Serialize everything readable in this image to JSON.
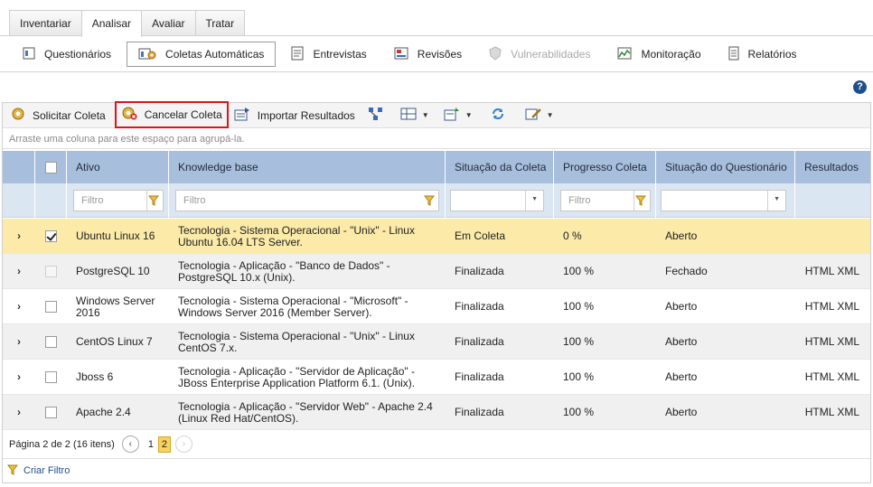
{
  "top_tabs": [
    "Inventariar",
    "Analisar",
    "Avaliar",
    "Tratar"
  ],
  "active_tab": "Analisar",
  "subnav": [
    {
      "label": "Questionários",
      "icon": "questionnaire-icon",
      "state": "normal"
    },
    {
      "label": "Coletas Automáticas",
      "icon": "automatic-collection-icon",
      "state": "active"
    },
    {
      "label": "Entrevistas",
      "icon": "interview-icon",
      "state": "normal"
    },
    {
      "label": "Revisões",
      "icon": "review-icon",
      "state": "normal"
    },
    {
      "label": "Vulnerabilidades",
      "icon": "vulnerability-icon",
      "state": "disabled"
    },
    {
      "label": "Monitoração",
      "icon": "monitoring-chart-icon",
      "state": "normal"
    },
    {
      "label": "Relatórios",
      "icon": "report-icon",
      "state": "normal"
    }
  ],
  "help": "?",
  "toolbar": {
    "request": "Solicitar Coleta",
    "cancel": "Cancelar Coleta",
    "import": "Importar Resultados"
  },
  "group_hint": "Arraste uma coluna para este espaço para agrupá-la.",
  "columns": {
    "ativo": "Ativo",
    "kb": "Knowledge base",
    "situacao": "Situação da Coleta",
    "progresso": "Progresso Coleta",
    "questionario": "Situação do Questionário",
    "resultados": "Resultados"
  },
  "filters": {
    "ativo": "Filtro",
    "kb": "Filtro",
    "progresso": "Filtro"
  },
  "rows": [
    {
      "ativo": "Ubuntu Linux 16",
      "kb": "Tecnologia - Sistema Operacional - \"Unix\" - Linux Ubuntu 16.04 LTS Server.",
      "situacao": "Em Coleta",
      "progresso": "0 %",
      "questionario": "Aberto",
      "resultados": "",
      "checked": true,
      "selected": true
    },
    {
      "ativo": "PostgreSQL 10",
      "kb": "Tecnologia - Aplicação - \"Banco de Dados\" - PostgreSQL 10.x (Unix).",
      "situacao": "Finalizada",
      "progresso": "100 %",
      "questionario": "Fechado",
      "resultados": "HTML XML",
      "checked": false,
      "disabled": true
    },
    {
      "ativo": "Windows Server 2016",
      "kb": "Tecnologia - Sistema Operacional - \"Microsoft\" - Windows Server 2016 (Member Server).",
      "situacao": "Finalizada",
      "progresso": "100 %",
      "questionario": "Aberto",
      "resultados": "HTML XML",
      "checked": false
    },
    {
      "ativo": "CentOS Linux 7",
      "kb": "Tecnologia - Sistema Operacional - \"Unix\" - Linux CentOS 7.x.",
      "situacao": "Finalizada",
      "progresso": "100 %",
      "questionario": "Aberto",
      "resultados": "HTML XML",
      "checked": false
    },
    {
      "ativo": "Jboss 6",
      "kb": "Tecnologia - Aplicação - \"Servidor de Aplicação\" - JBoss Enterprise Application Platform 6.1. (Unix).",
      "situacao": "Finalizada",
      "progresso": "100 %",
      "questionario": "Aberto",
      "resultados": "HTML XML",
      "checked": false
    },
    {
      "ativo": "Apache 2.4",
      "kb": "Tecnologia - Aplicação - \"Servidor Web\" - Apache 2.4 (Linux Red Hat/CentOS).",
      "situacao": "Finalizada",
      "progresso": "100 %",
      "questionario": "Aberto",
      "resultados": "HTML XML",
      "checked": false
    }
  ],
  "pager": {
    "info": "Página 2 de 2 (16 itens)",
    "pages": [
      "1",
      "2"
    ],
    "current": "2"
  },
  "footer_link": "Criar Filtro",
  "colors": {
    "header": "#a7bfdd",
    "filter_row": "#dbe6f3",
    "selected_row": "#fbeaa8",
    "highlight_border": "#e0121a",
    "link": "#1f4e8c"
  }
}
